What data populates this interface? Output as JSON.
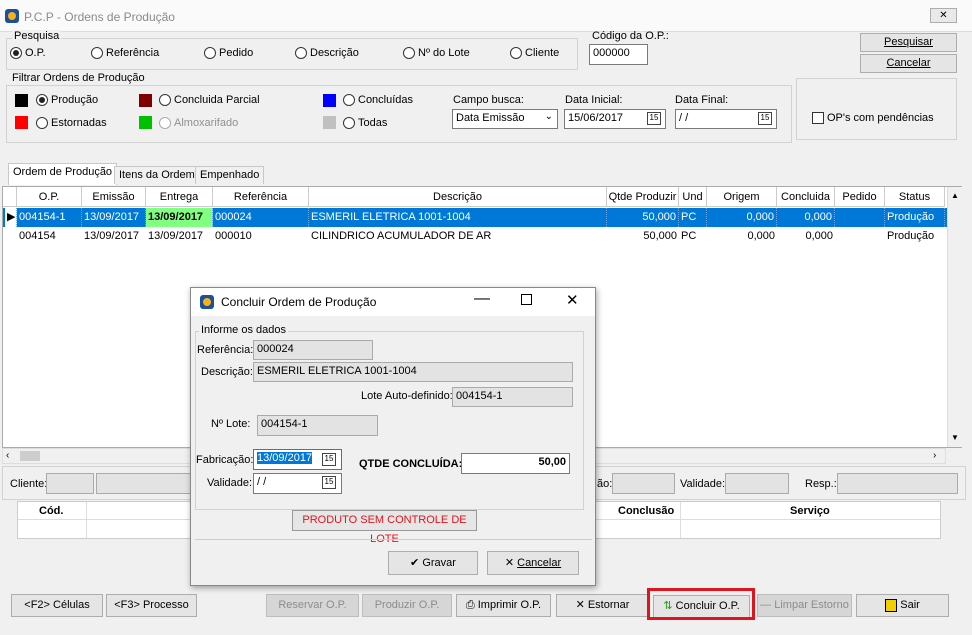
{
  "window": {
    "title": "P.C.P - Ordens de Produção",
    "close_label": "✕"
  },
  "pesquisa": {
    "label": "Pesquisa",
    "options": [
      "O.P.",
      "Referência",
      "Pedido",
      "Descrição",
      "Nº do Lote",
      "Cliente"
    ],
    "selected": "O.P."
  },
  "codigo_op": {
    "label": "Código da O.P.:",
    "value": "000000"
  },
  "actions": {
    "pesquisar": "Pesquisar",
    "cancelar": "Cancelar"
  },
  "filtrar": {
    "label": "Filtrar Ordens de Produção",
    "options": [
      {
        "label": "Produção",
        "color": "#000000",
        "selected": true
      },
      {
        "label": "Estornadas",
        "color": "#ff0000",
        "selected": false
      },
      {
        "label": "Concluida Parcial",
        "color": "#800000",
        "selected": false
      },
      {
        "label": "Almoxarifado",
        "color": "#00c000",
        "selected": false
      },
      {
        "label": "Concluídas",
        "color": "#0000ff",
        "selected": false
      },
      {
        "label": "Todas",
        "color": "#c0c0c0",
        "selected": false
      }
    ]
  },
  "campo_busca": {
    "label": "Campo busca:",
    "value": "Data Emissão"
  },
  "data_inicial": {
    "label": "Data Inicial:",
    "value": "15/06/2017"
  },
  "data_final": {
    "label": "Data Final:",
    "value": " /  /"
  },
  "pendencias": {
    "label": "OP's com pendências"
  },
  "tabs": [
    "Ordem de Produção",
    "Itens da Ordem",
    "Empenhado"
  ],
  "grid": {
    "columns": [
      "O.P.",
      "Emissão",
      "Entrega",
      "Referência",
      "Descrição",
      "Qtde Produzir",
      "Und",
      "Origem",
      "Concluida",
      "Pedido",
      "Status"
    ],
    "rows": [
      [
        "004154-1",
        "13/09/2017",
        "13/09/2017",
        "000024",
        "ESMERIL ELETRICA 1001-1004",
        "50,000",
        "PC",
        "0,000",
        "0,000",
        "",
        "Produção"
      ],
      [
        "004154",
        "13/09/2017",
        "13/09/2017",
        "000010",
        "CILINDRICO ACUMULADOR DE AR",
        "50,000",
        "PC",
        "0,000",
        "0,000",
        "",
        "Produção"
      ]
    ]
  },
  "lower": {
    "cliente_label": "Cliente:",
    "validade_label": "Validade:",
    "resp_label": "Resp.:",
    "partial_label": "ão:",
    "cod_header": "Cód.",
    "conclusao_header": "Conclusão",
    "servico_header": "Serviço"
  },
  "dialog": {
    "title": "Concluir Ordem de Produção",
    "group_label": "Informe os dados",
    "referencia_label": "Referência:",
    "referencia_value": "000024",
    "descricao_label": "Descrição:",
    "descricao_value": "ESMERIL ELETRICA 1001-1004",
    "lote_auto_label": "Lote Auto-definido:",
    "lote_auto_value": "004154-1",
    "lote_label": "Nº Lote:",
    "lote_value": "004154-1",
    "fabricacao_label": "Fabricação:",
    "fabricacao_value": "13/09/2017",
    "validade_label": "Validade:",
    "validade_value": " /  /",
    "qtde_label": "QTDE CONCLUÍDA:",
    "qtde_value": "50,00",
    "warning": "PRODUTO SEM CONTROLE DE LOTE",
    "gravar": "Gravar",
    "cancelar": "Cancelar"
  },
  "bottom_buttons": {
    "celulas": "<F2> Células",
    "processo": "<F3> Processo",
    "reservar": "Reservar O.P.",
    "produzir": "Produzir O.P.",
    "imprimir": "Imprimir O.P.",
    "estornar": "Estornar",
    "concluir": "Concluir O.P.",
    "limpar": "Limpar Estorno",
    "sair": "Sair"
  }
}
